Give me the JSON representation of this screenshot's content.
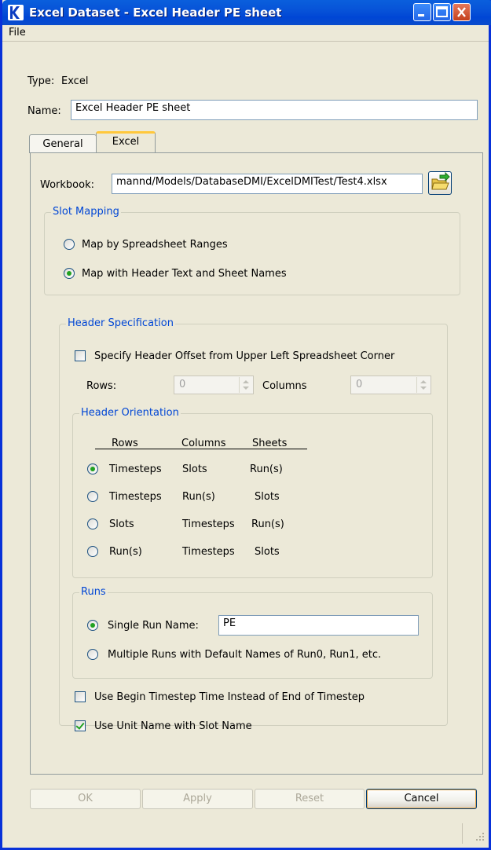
{
  "window": {
    "title": "Excel Dataset - Excel Header PE sheet"
  },
  "menu": {
    "file": "File"
  },
  "type_row": {
    "label": "Type:",
    "value": "Excel"
  },
  "name_row": {
    "label": "Name:",
    "value": "Excel Header PE sheet"
  },
  "tabs": [
    {
      "label": "General"
    },
    {
      "label": "Excel"
    }
  ],
  "workbook": {
    "label": "Workbook:",
    "value": "mannd/Models/DatabaseDMI/ExcelDMITest/Test4.xlsx",
    "icon": "folder-open-icon"
  },
  "slot_mapping": {
    "legend": "Slot Mapping",
    "options": [
      {
        "label": "Map by Spreadsheet Ranges",
        "selected": false
      },
      {
        "label": "Map with Header Text and Sheet Names",
        "selected": true
      }
    ]
  },
  "header_spec": {
    "legend": "Header Specification",
    "offset_checkbox": {
      "label": "Specify Header Offset from Upper Left Spreadsheet Corner",
      "checked": false
    },
    "rows_label": "Rows:",
    "rows_value": "0",
    "columns_label": "Columns",
    "columns_value": "0"
  },
  "orientation": {
    "legend": "Header Orientation",
    "headers": [
      "Rows",
      "Columns",
      "Sheets"
    ],
    "options": [
      {
        "rows": "Timesteps",
        "columns": "Slots",
        "sheets": "Run(s)",
        "selected": true
      },
      {
        "rows": "Timesteps",
        "columns": "Run(s)",
        "sheets": "Slots",
        "selected": false
      },
      {
        "rows": "Slots",
        "columns": "Timesteps",
        "sheets": "Run(s)",
        "selected": false
      },
      {
        "rows": "Run(s)",
        "columns": "Timesteps",
        "sheets": "Slots",
        "selected": false
      }
    ]
  },
  "runs": {
    "legend": "Runs",
    "single_label": "Single Run Name:",
    "single_value": "PE",
    "single_selected": true,
    "multiple_label": "Multiple Runs with Default Names of Run0, Run1, etc.",
    "multiple_selected": false
  },
  "checkboxes": {
    "begin_timestep": {
      "label": "Use Begin Timestep Time Instead of End of Timestep",
      "checked": false
    },
    "unit_name": {
      "label": "Use Unit Name with Slot Name",
      "checked": true
    }
  },
  "buttons": {
    "ok": "OK",
    "apply": "Apply",
    "reset": "Reset",
    "cancel": "Cancel"
  },
  "colors": {
    "titlebar": "#0054e3",
    "legend_text": "#0046d5",
    "radio_selected": "#21a121"
  }
}
